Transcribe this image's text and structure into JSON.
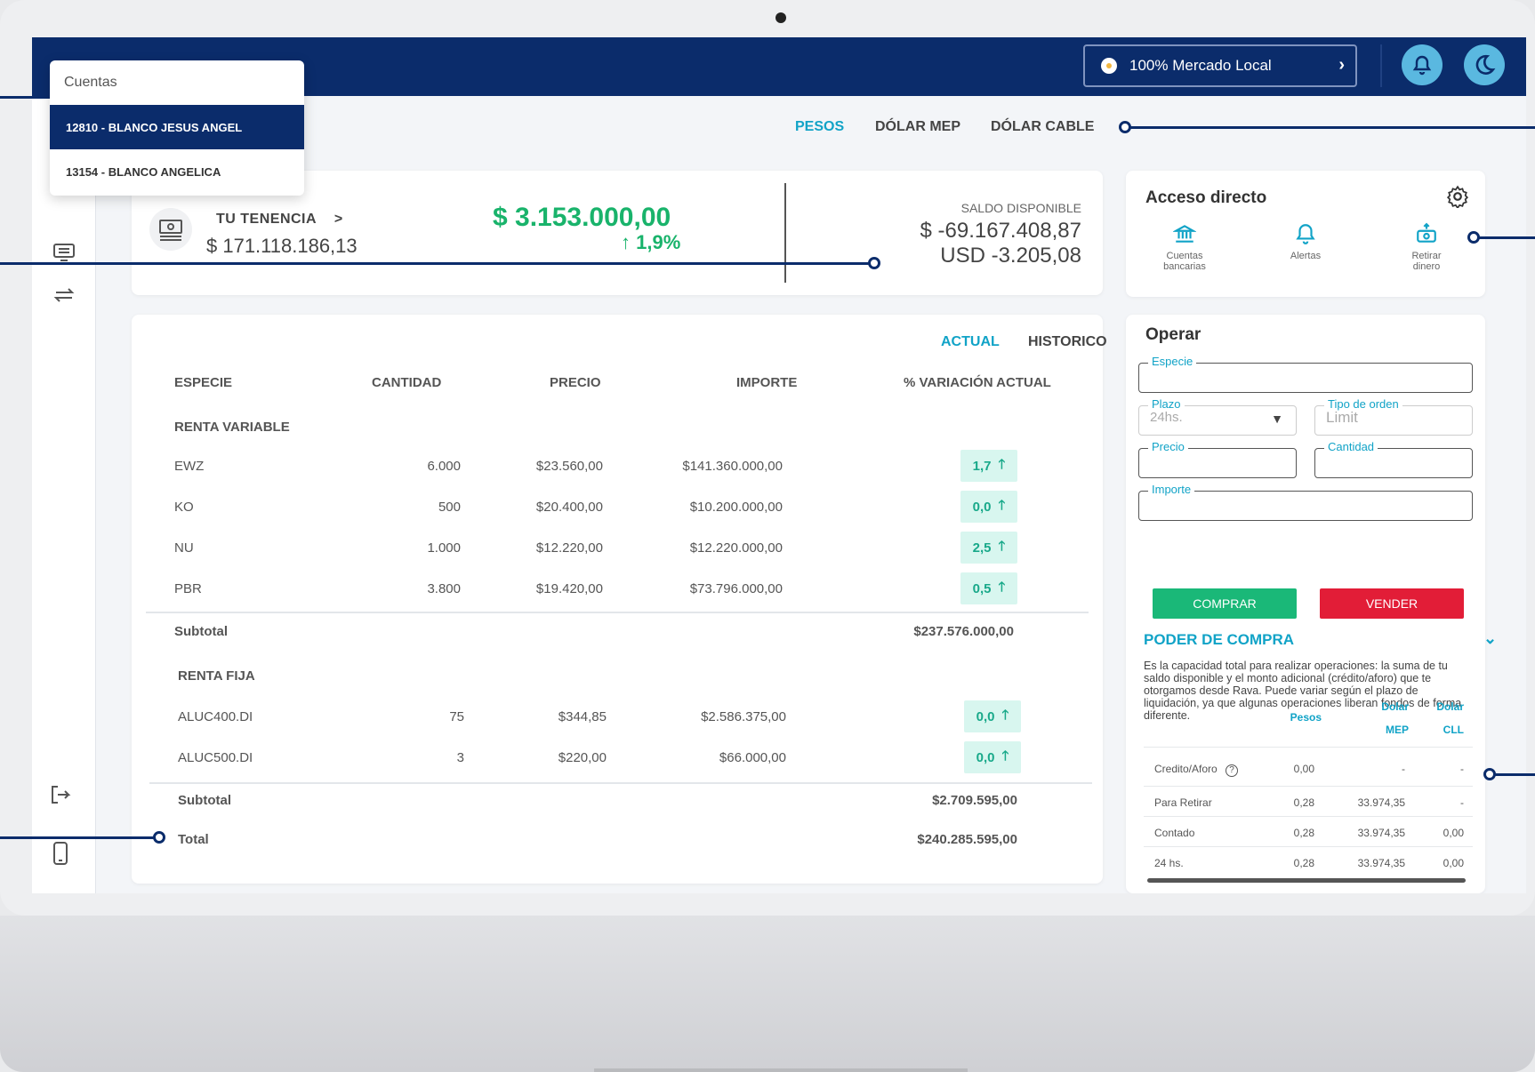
{
  "topbar": {
    "market_label": "100% Mercado Local"
  },
  "accounts": {
    "title": "Cuentas",
    "items": [
      {
        "label": "12810 - BLANCO JESUS ANGEL",
        "selected": true
      },
      {
        "label": "13154 - BLANCO ANGELICA",
        "selected": false
      }
    ]
  },
  "currency_tabs": [
    {
      "label": "PESOS",
      "active": true
    },
    {
      "label": "DÓLAR MEP",
      "active": false
    },
    {
      "label": "DÓLAR CABLE",
      "active": false
    }
  ],
  "summary": {
    "tenencia_label": "TU TENENCIA",
    "tenencia_chevron": ">",
    "tenencia_value": "$ 171.118.186,13",
    "variation_value": "$ 3.153.000,00",
    "variation_pct": "↑ 1,9%",
    "saldo_label": "SALDO DISPONIBLE",
    "saldo_ars": "$ -69.167.408,87",
    "saldo_usd": "USD -3.205,08"
  },
  "holdings": {
    "view_tabs": [
      {
        "label": "ACTUAL",
        "active": true
      },
      {
        "label": "HISTORICO",
        "active": false
      }
    ],
    "columns": [
      "ESPECIE",
      "CANTIDAD",
      "PRECIO",
      "IMPORTE",
      "% VARIACIÓN ACTUAL"
    ],
    "renta_variable": {
      "label": "RENTA VARIABLE",
      "rows": [
        {
          "especie": "EWZ",
          "cantidad": "6.000",
          "precio": "$23.560,00",
          "importe": "$141.360.000,00",
          "variacion": "1,7"
        },
        {
          "especie": "KO",
          "cantidad": "500",
          "precio": "$20.400,00",
          "importe": "$10.200.000,00",
          "variacion": "0,0"
        },
        {
          "especie": "NU",
          "cantidad": "1.000",
          "precio": "$12.220,00",
          "importe": "$12.220.000,00",
          "variacion": "2,5"
        },
        {
          "especie": "PBR",
          "cantidad": "3.800",
          "precio": "$19.420,00",
          "importe": "$73.796.000,00",
          "variacion": "0,5"
        }
      ],
      "subtotal_label": "Subtotal",
      "subtotal_value": "$237.576.000,00"
    },
    "renta_fija": {
      "label": "RENTA FIJA",
      "rows": [
        {
          "especie": "ALUC400.DI",
          "cantidad": "75",
          "precio": "$344,85",
          "importe": "$2.586.375,00",
          "variacion": "0,0"
        },
        {
          "especie": "ALUC500.DI",
          "cantidad": "3",
          "precio": "$220,00",
          "importe": "$66.000,00",
          "variacion": "0,0"
        }
      ],
      "subtotal_label": "Subtotal",
      "subtotal_value": "$2.709.595,00"
    },
    "total_label": "Total",
    "total_value": "$240.285.595,00"
  },
  "acceso_directo": {
    "title": "Acceso directo",
    "items": [
      {
        "icon": "bank-icon",
        "label_1": "Cuentas",
        "label_2": "bancarias"
      },
      {
        "icon": "bell-icon",
        "label_1": "Alertas",
        "label_2": ""
      },
      {
        "icon": "withdraw-icon",
        "label_1": "Retirar",
        "label_2": "dinero"
      }
    ]
  },
  "operar": {
    "title": "Operar",
    "especie_label": "Especie",
    "plazo_label": "Plazo",
    "plazo_value": "24hs.",
    "tipo_label": "Tipo de orden",
    "tipo_placeholder": "Limit",
    "precio_label": "Precio",
    "cantidad_label": "Cantidad",
    "importe_label": "Importe",
    "buy_label": "COMPRAR",
    "sell_label": "VENDER"
  },
  "poder_compra": {
    "title": "PODER DE COMPRA",
    "description": "Es la capacidad total para realizar operaciones: la suma de tu saldo disponible y el monto adicional (crédito/aforo) que te otorgamos desde Rava. Puede variar según el plazo de liquidación, ya que algunas operaciones liberan fondos de forma diferente.",
    "headers": {
      "pesos": "Pesos",
      "mep_1": "Dolar",
      "mep_2": "MEP",
      "cll_1": "Dolar",
      "cll_2": "CLL"
    },
    "rows": [
      {
        "label": "Credito/Aforo",
        "pesos": "0,00",
        "mep": "-",
        "cll": "-"
      },
      {
        "label": "Para Retirar",
        "pesos": "0,28",
        "mep": "33.974,35",
        "cll": "-"
      },
      {
        "label": "Contado",
        "pesos": "0,28",
        "mep": "33.974,35",
        "cll": "0,00"
      },
      {
        "label": "24 hs.",
        "pesos": "0,28",
        "mep": "33.974,35",
        "cll": "0,00"
      }
    ]
  },
  "colors": {
    "navy": "#0b2c6b",
    "accent": "#11a3c7",
    "positive": "#19b36b",
    "buy": "#1ab878",
    "sell": "#e21d37"
  }
}
